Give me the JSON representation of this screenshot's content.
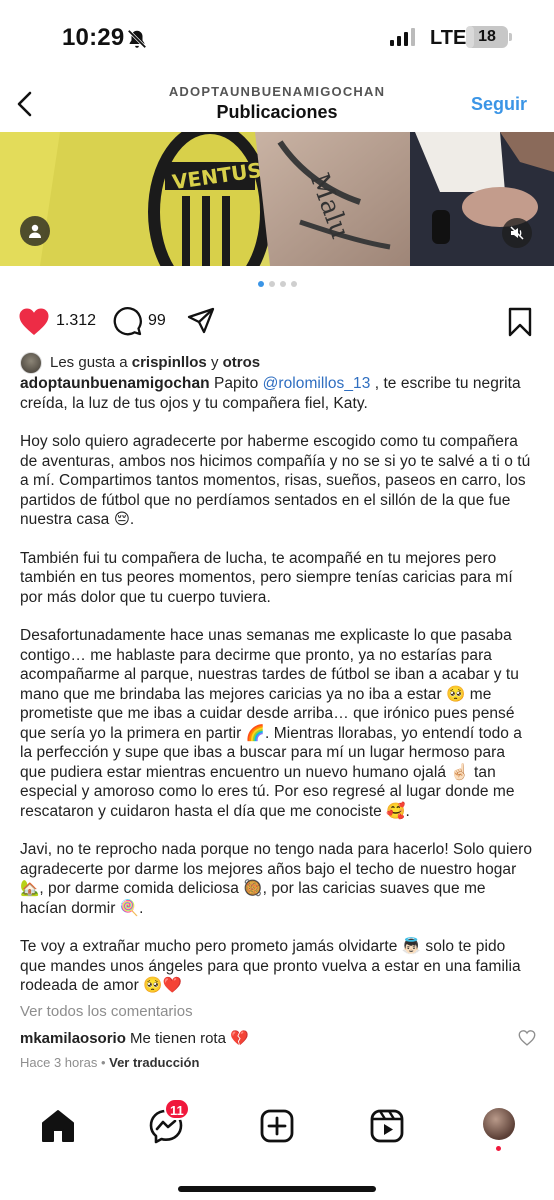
{
  "status_bar": {
    "time": "10:29",
    "network": "LTE",
    "battery": "18",
    "battery_level": 0.18,
    "signal_bars": 3,
    "icons": [
      "bell-slash-icon",
      "signal-icon",
      "battery-icon"
    ]
  },
  "header": {
    "account": "ADOPTAUNBUENAMIGOCHAN",
    "title": "Publicaciones",
    "follow_label": "Seguir",
    "back_icon": "chevron-left-icon"
  },
  "media": {
    "carousel_count": 4,
    "carousel_active": 1,
    "icons": [
      "user-tag-icon",
      "mute-icon"
    ]
  },
  "actions": {
    "likes": "1.312",
    "comments": "99",
    "icons": [
      "heart-filled-icon",
      "comment-icon",
      "share-icon",
      "bookmark-icon"
    ]
  },
  "liked_by": {
    "prefix": "Les gusta a",
    "user": "crispinllos",
    "connector": "y",
    "others": "otros"
  },
  "caption": {
    "username": "adoptaunbuenamigochan",
    "p1_before": " Papito ",
    "mention": "@rolomillos_13",
    "p1_after": " , te escribe tu negrita creída, la luz de tus ojos y tu compañera fiel, Katy.",
    "p2": "Hoy solo quiero agradecerte por haberme escogido como tu compañera de aventuras, ambos nos hicimos compañía y no se si yo te salvé a ti o tú a mí. Compartimos tantos momentos, risas, sueños, paseos en carro, los partidos de fútbol que no perdíamos sentados en el sillón de la que fue nuestra casa 😔.",
    "p3": "También fui tu compañera de lucha, te acompañé en tu mejores pero también en tus peores momentos, pero siempre tenías caricias para mí por más dolor que tu cuerpo tuviera.",
    "p4": "Desafortunadamente hace unas semanas me explicaste lo que pasaba contigo… me hablaste para decirme que pronto, ya no estarías para acompañarme al parque, nuestras tardes de fútbol se iban a acabar y tu mano que me brindaba las mejores caricias ya no iba a estar 🥺 me prometiste que me ibas a cuidar desde arriba… que irónico pues pensé que sería yo la primera en partir 🌈. Mientras llorabas, yo entendí todo a la perfección y supe que ibas a buscar para mí un lugar hermoso para que pudiera estar mientras encuentro un nuevo humano ojalá ☝🏻 tan especial y amoroso como lo eres tú. Por eso regresé al lugar donde me rescataron y cuidaron hasta el día que me conociste 🥰.",
    "p5": "Javi, no te reprocho nada porque no tengo nada para hacerlo! Solo quiero agradecerte por darme los mejores años bajo el techo de nuestro hogar 🏡, por darme comida deliciosa 🥘, por las caricias suaves que me hacían dormir 🍭.",
    "p6": "Te voy a extrañar mucho pero prometo jamás olvidarte 👼🏻 solo te pido que mandes unos ángeles para que pronto vuelva a estar en una familia rodeada de amor 🥺❤️"
  },
  "comments_section": {
    "view_all": "Ver todos los comentarios",
    "comment_user": "mkamilaosorio",
    "comment_text": " Me tienen rota 💔",
    "time": "Hace 3 horas",
    "separator": " • ",
    "translate": "Ver traducción"
  },
  "bottom_nav": {
    "messages_badge": "11",
    "icons": [
      "home-icon",
      "messenger-icon",
      "create-icon",
      "reels-icon",
      "profile-avatar"
    ]
  },
  "colors": {
    "accent": "#3b95e6",
    "like": "#ed2c46",
    "badge": "#f0183c",
    "mention": "#2f6ec0"
  }
}
